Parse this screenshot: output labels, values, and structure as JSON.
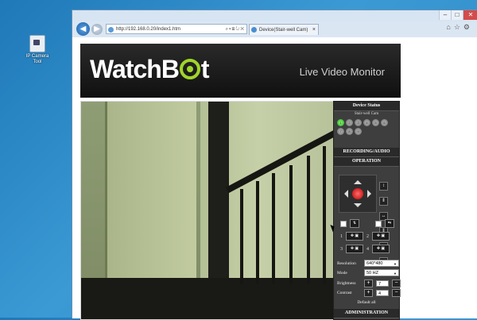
{
  "desktop": {
    "icon_label_line1": "IP Camera",
    "icon_label_line2": "Tool"
  },
  "browser": {
    "address": "http://192.168.0.20/index1.htm",
    "tab_title": "Device(Stair-well Cam)"
  },
  "header": {
    "logo_pre": "Watch",
    "logo_post": "B",
    "logo_end": "t",
    "tagline": "Live Video Monitor"
  },
  "panel": {
    "device_status": "Device Status",
    "device_name": "Stair-well Cam",
    "channels": [
      "1",
      "2",
      "3",
      "4",
      "5",
      "6",
      "7",
      "8",
      "9"
    ],
    "recording": "RECORDING/AUDIO",
    "operation": "OPERATION",
    "presets": [
      "1",
      "2",
      "3",
      "4"
    ],
    "resolution_label": "Resolution",
    "resolution_value": "640*480",
    "mode_label": "Mode",
    "mode_value": "50 HZ",
    "brightness_label": "Brightness",
    "brightness_value": "7",
    "contrast_label": "Contrast",
    "contrast_value": "4",
    "default_all": "Default all",
    "administration": "ADMINISTRATION"
  }
}
